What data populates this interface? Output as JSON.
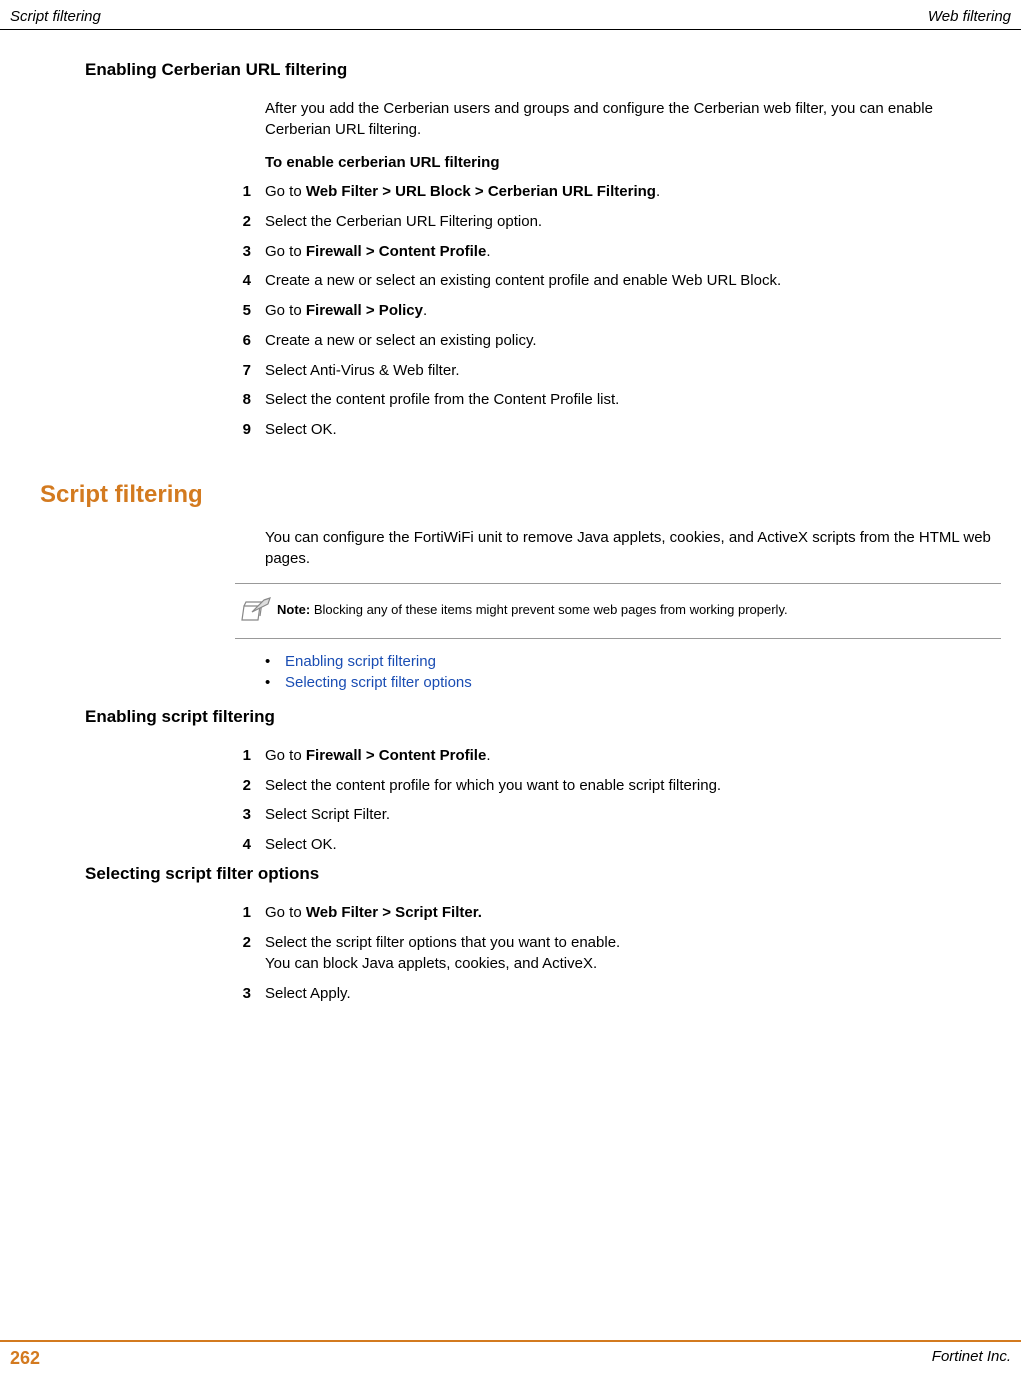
{
  "header": {
    "left": "Script filtering",
    "right": "Web filtering"
  },
  "section1": {
    "heading": "Enabling Cerberian URL filtering",
    "intro": "After you add the Cerberian users and groups and configure the Cerberian web filter, you can enable Cerberian URL filtering.",
    "procedureTitle": "To enable cerberian URL filtering",
    "steps": [
      {
        "num": "1",
        "pre": "Go to ",
        "strong": "Web Filter > URL Block > Cerberian URL Filtering",
        "post": "."
      },
      {
        "num": "2",
        "text": "Select the Cerberian URL Filtering option."
      },
      {
        "num": "3",
        "pre": "Go to ",
        "strong": "Firewall > Content Profile",
        "post": "."
      },
      {
        "num": "4",
        "text": "Create a new or select an existing content profile and enable Web URL Block."
      },
      {
        "num": "5",
        "pre": "Go to ",
        "strong": "Firewall > Policy",
        "post": "."
      },
      {
        "num": "6",
        "text": "Create a new or select an existing policy."
      },
      {
        "num": "7",
        "text": "Select Anti-Virus & Web filter."
      },
      {
        "num": "8",
        "text": "Select the content profile from the Content Profile list."
      },
      {
        "num": "9",
        "text": "Select OK."
      }
    ]
  },
  "section2": {
    "heading": "Script filtering",
    "intro": "You can configure the FortiWiFi unit to remove Java applets, cookies, and ActiveX scripts from the HTML web pages.",
    "noteLabel": "Note:",
    "noteText": " Blocking any of these items might prevent some web pages from working properly.",
    "bullets": [
      "Enabling script filtering",
      "Selecting script filter options"
    ]
  },
  "section3": {
    "heading": "Enabling script filtering",
    "steps": [
      {
        "num": "1",
        "pre": "Go to ",
        "strong": "Firewall > Content Profile",
        "post": "."
      },
      {
        "num": "2",
        "text": "Select the content profile for which you want to enable script filtering."
      },
      {
        "num": "3",
        "text": "Select Script Filter."
      },
      {
        "num": "4",
        "text": "Select OK."
      }
    ]
  },
  "section4": {
    "heading": "Selecting script filter options",
    "steps": [
      {
        "num": "1",
        "pre": "Go to ",
        "strong": "Web Filter > Script Filter.",
        "post": ""
      },
      {
        "num": "2",
        "text": "Select the script filter options that you want to enable.",
        "text2": "You can block Java applets, cookies, and ActiveX."
      },
      {
        "num": "3",
        "text": "Select Apply."
      }
    ]
  },
  "footer": {
    "pageNumber": "262",
    "right": "Fortinet Inc."
  }
}
